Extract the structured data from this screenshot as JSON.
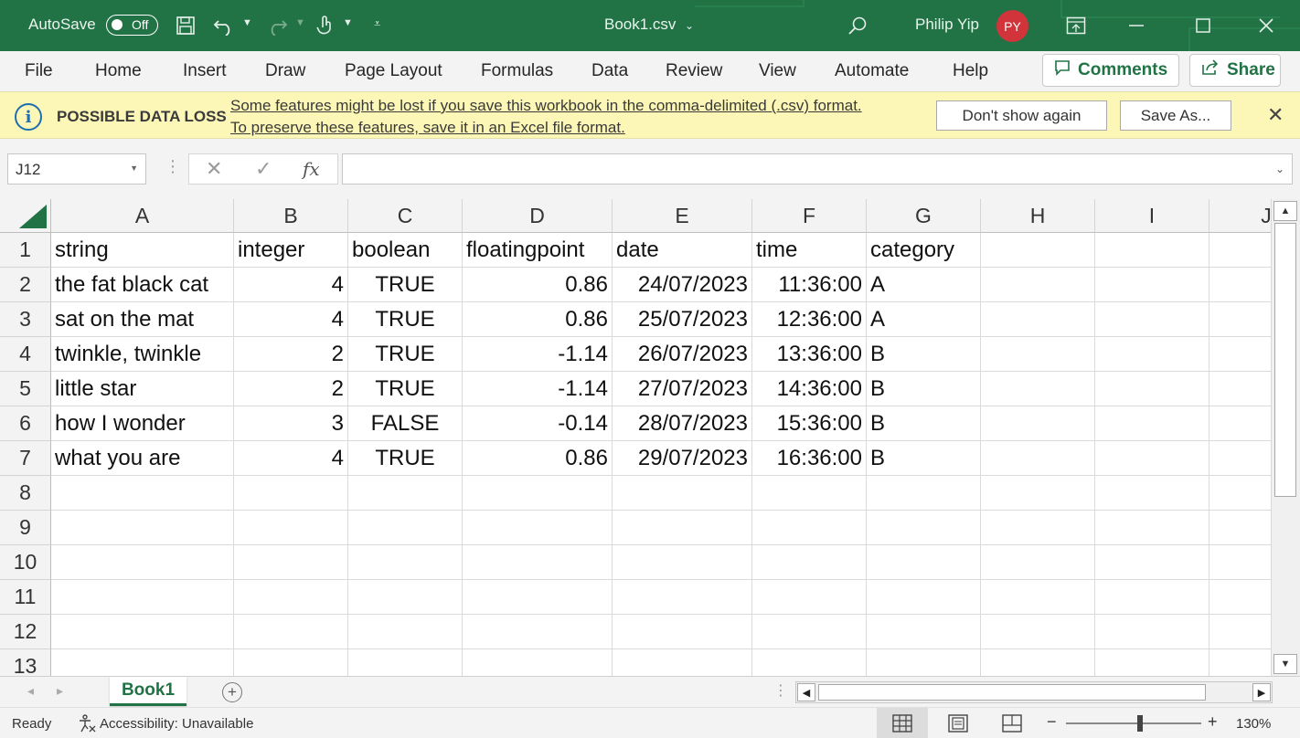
{
  "titlebar": {
    "autosave_label": "AutoSave",
    "autosave_state": "Off",
    "file_title": "Book1.csv",
    "user_name": "Philip Yip",
    "user_initials": "PY",
    "accent_color": "#217346"
  },
  "ribbon": {
    "tabs": [
      "File",
      "Home",
      "Insert",
      "Draw",
      "Page Layout",
      "Formulas",
      "Data",
      "Review",
      "View",
      "Automate",
      "Help"
    ],
    "comments_label": "Comments",
    "share_label": "Share"
  },
  "warning": {
    "title": "POSSIBLE DATA LOSS",
    "line1": "Some features might be lost if you save this workbook in the comma-delimited (.csv) format.",
    "line2": "To preserve these features, save it in an Excel file format.",
    "dont_show_label": "Don't show again",
    "save_as_label": "Save As..."
  },
  "formula_bar": {
    "name_box": "J12",
    "fx_label": "fx",
    "formula": ""
  },
  "grid": {
    "columns": [
      "A",
      "B",
      "C",
      "D",
      "E",
      "F",
      "G",
      "H",
      "I",
      "J"
    ],
    "row_numbers": [
      "1",
      "2",
      "3",
      "4",
      "5",
      "6",
      "7",
      "8",
      "9",
      "10",
      "11",
      "12",
      "13"
    ],
    "rows": [
      [
        "string",
        "integer",
        "boolean",
        "floatingpoint",
        "date",
        "time",
        "category"
      ],
      [
        "the fat black cat",
        "4",
        "TRUE",
        "0.86",
        "24/07/2023",
        "11:36:00",
        "A"
      ],
      [
        "sat on the mat",
        "4",
        "TRUE",
        "0.86",
        "25/07/2023",
        "12:36:00",
        "A"
      ],
      [
        "twinkle, twinkle",
        "2",
        "TRUE",
        "-1.14",
        "26/07/2023",
        "13:36:00",
        "B"
      ],
      [
        "little star",
        "2",
        "TRUE",
        "-1.14",
        "27/07/2023",
        "14:36:00",
        "B"
      ],
      [
        "how I wonder",
        "3",
        "FALSE",
        "-0.14",
        "28/07/2023",
        "15:36:00",
        "B"
      ],
      [
        "what you are",
        "4",
        "TRUE",
        "0.86",
        "29/07/2023",
        "16:36:00",
        "B"
      ]
    ]
  },
  "sheets": {
    "active": "Book1"
  },
  "status": {
    "ready": "Ready",
    "accessibility": "Accessibility: Unavailable",
    "zoom_minus": "−",
    "zoom_plus": "+",
    "zoom": "130%"
  }
}
